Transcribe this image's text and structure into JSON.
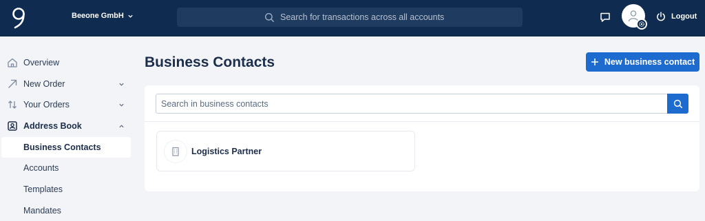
{
  "header": {
    "company": "Beeone GmbH",
    "search_placeholder": "Search for transactions across all accounts",
    "logout_label": "Logout"
  },
  "sidebar": {
    "items": [
      {
        "label": "Overview",
        "icon": "home-icon"
      },
      {
        "label": "New Order",
        "icon": "arrow-up-right-icon"
      },
      {
        "label": "Your Orders",
        "icon": "swap-arrows-icon"
      },
      {
        "label": "Address Book",
        "icon": "address-book-icon"
      }
    ],
    "sub_items": [
      "Business Contacts",
      "Accounts",
      "Templates",
      "Mandates"
    ]
  },
  "main": {
    "title": "Business Contacts",
    "new_button_label": "New business contact",
    "search_placeholder": "Search in business contacts",
    "contacts": [
      {
        "name": "Logistics Partner",
        "icon": "building-icon"
      }
    ]
  },
  "colors": {
    "topbar": "#0f2b50",
    "accent": "#1e6bcf",
    "background": "#f2f4f7"
  }
}
